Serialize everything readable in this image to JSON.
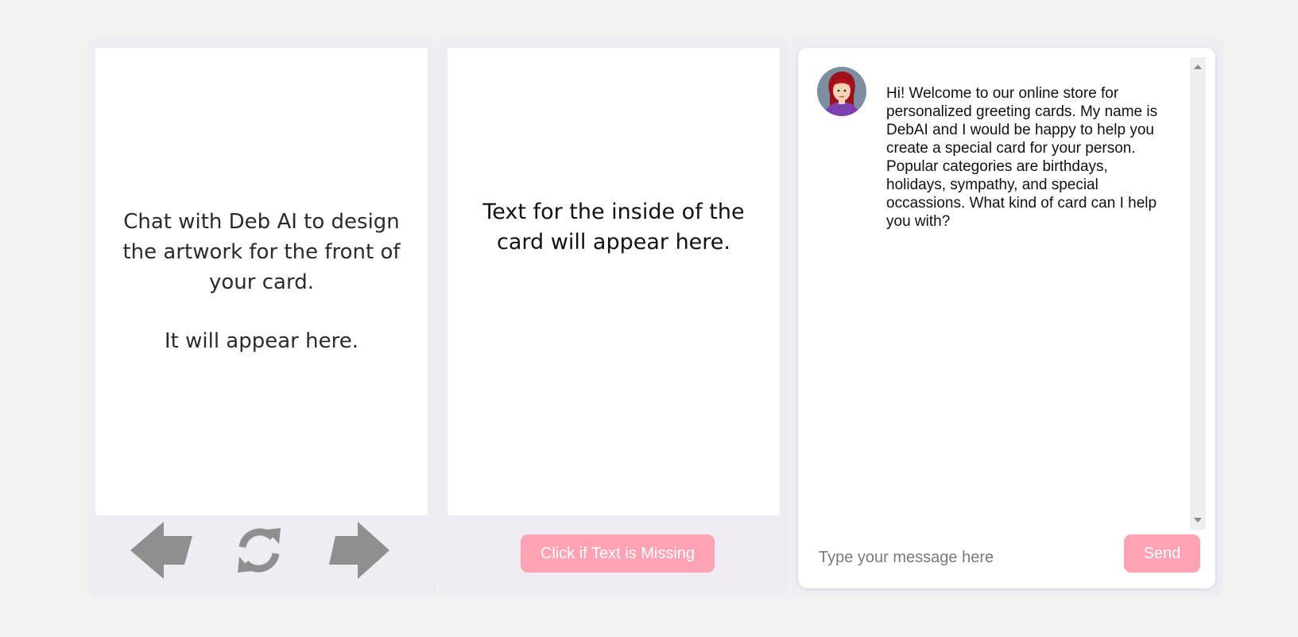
{
  "front_card": {
    "lines": [
      "Chat with Deb AI to design the artwork for the front of your card.",
      "It will appear here."
    ]
  },
  "inside_card": {
    "text": "Text for the inside of the card will appear here."
  },
  "nav": {
    "prev_icon": "left-arrow-icon",
    "flip_icon": "refresh-icon",
    "next_icon": "right-arrow-icon"
  },
  "buttons": {
    "missing_text_label": "Click if Text is Missing",
    "send_label": "Send"
  },
  "chat": {
    "messages": [
      {
        "sender": "DebAI",
        "text": "Hi! Welcome to our online store for personalized greeting cards. My name is DebAI and I would be happy to help you create a special card for your person. Popular categories are birthdays, holidays, sympathy, and special occassions. What kind of card can I help you with?"
      }
    ],
    "input_placeholder": "Type your message here"
  },
  "colors": {
    "accent_pink": "#ffa3b4",
    "icon_gray": "#8f8f8f",
    "panel_bg": "#efedf3",
    "page_bg": "#f2f2f3"
  }
}
